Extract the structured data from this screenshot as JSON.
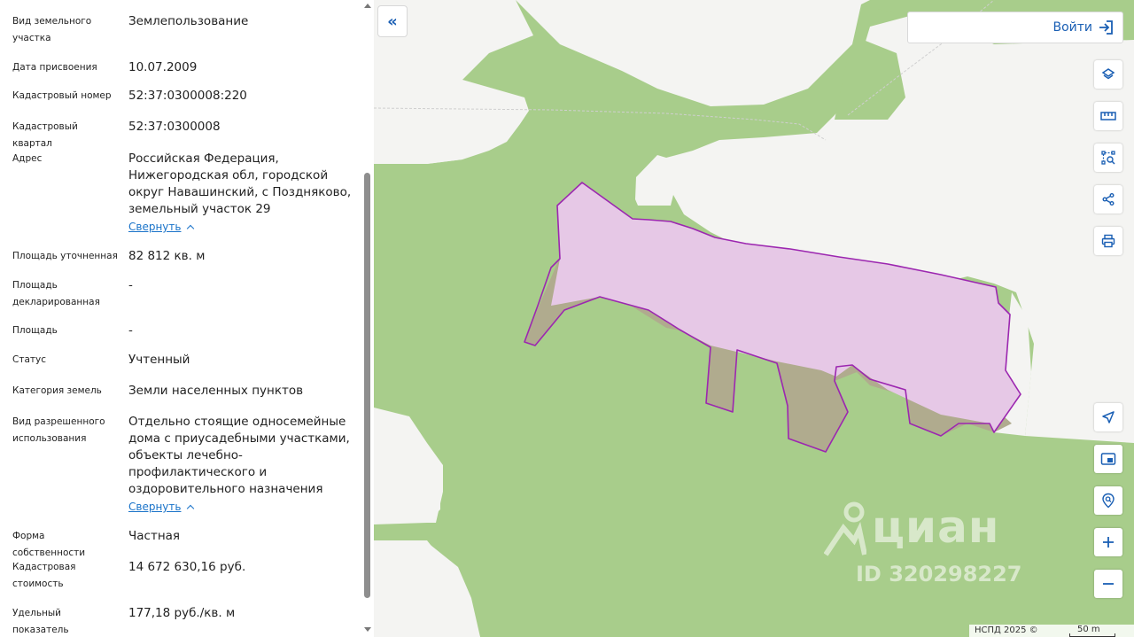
{
  "panel": {
    "rows": [
      {
        "label": "Вид земельного участка",
        "value": [
          "Землепользование"
        ]
      },
      {
        "label": "Дата присвоения",
        "value": [
          "10.07.2009"
        ]
      },
      {
        "label": "Кадастровый номер",
        "value": [
          "52:37:0300008:220"
        ]
      },
      {
        "label": "Кадастровый квартал",
        "value": [
          "52:37:0300008"
        ]
      },
      {
        "label": "Адрес",
        "value": [
          "Российская Федерация,",
          "Нижегородская обл, городской",
          "округ Навашинский, с Поздняково,",
          "земельный участок 29"
        ],
        "collapse": "Свернуть"
      },
      {
        "label": "Площадь уточненная",
        "value": [
          "82 812 кв. м"
        ]
      },
      {
        "label": "Площадь декларированная",
        "value": [
          "-"
        ]
      },
      {
        "label": "Площадь",
        "value": [
          "-"
        ]
      },
      {
        "label": "Статус",
        "value": [
          "Учтенный"
        ]
      },
      {
        "label": "Категория земель",
        "value": [
          "Земли населенных пунктов"
        ]
      },
      {
        "label": "Вид разрешенного использования",
        "value": [
          "Отдельно стоящие односемейные",
          "дома с приусадебными участками,",
          "объекты лечебно-",
          "профилактического и",
          "оздоровительного назначения"
        ],
        "collapse": "Свернуть"
      },
      {
        "label": "Форма собственности",
        "value": [
          "Частная"
        ]
      },
      {
        "label": "Кадастровая стоимость",
        "value": [
          "14 672 630,16 руб."
        ]
      },
      {
        "label": "Удельный показатель кадастровой",
        "value": [
          "177,18 руб./кв. м"
        ]
      }
    ]
  },
  "map": {
    "collapse_icon": "«",
    "login_label": "Войти",
    "tools": [
      "layers-icon",
      "ruler-icon",
      "select-area-icon",
      "share-icon",
      "print-icon",
      "geolocate-icon",
      "minimap-icon",
      "search-location-icon",
      "zoom-in-icon",
      "zoom-out-icon"
    ],
    "watermark_brand": "циан",
    "watermark_id": "ID 320298227",
    "attribution": "НСПД 2025 ©",
    "scale_label": "50 m",
    "colors": {
      "forest": "#a8cd8b",
      "open_land": "#f4f4f2",
      "parcel_fill": "#e6c8e6",
      "parcel_stroke": "#9c27b0",
      "accent": "#1a5fb4"
    }
  }
}
